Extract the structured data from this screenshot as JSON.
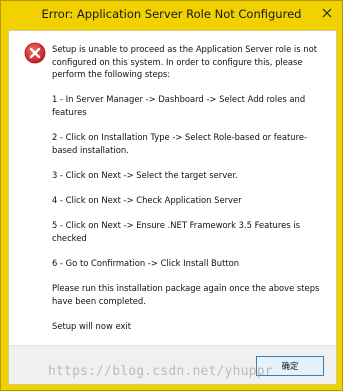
{
  "window": {
    "title": "Error: Application Server Role Not Configured",
    "close_glyph": "✕"
  },
  "icons": {
    "error": "error-icon",
    "close": "close-icon"
  },
  "message": {
    "paragraphs": [
      "Setup is unable to proceed as the Application Server role is not configured on this system.  In order to configure this, please perform the following steps:",
      "1 - In Server Manager -> Dashboard -> Select Add roles and features",
      "2 - Click on Installation Type -> Select Role-based or feature-based installation.",
      "3 - Click on Next -> Select the target server.",
      "4 - Click on Next -> Check Application Server",
      "5 - Click on Next -> Ensure .NET Framework 3.5 Features is checked",
      "6 - Go to Confirmation -> Click Install Button",
      "Please run this installation package again once the above steps have been completed.",
      "Setup will now exit"
    ]
  },
  "buttons": {
    "ok_label": "确定"
  },
  "watermark": {
    "text": "https://blog.csdn.net/yhuppr"
  },
  "colors": {
    "titlebar": "#f1d100",
    "error_icon": "#d32f2f",
    "button_border": "#3c7fb1"
  }
}
